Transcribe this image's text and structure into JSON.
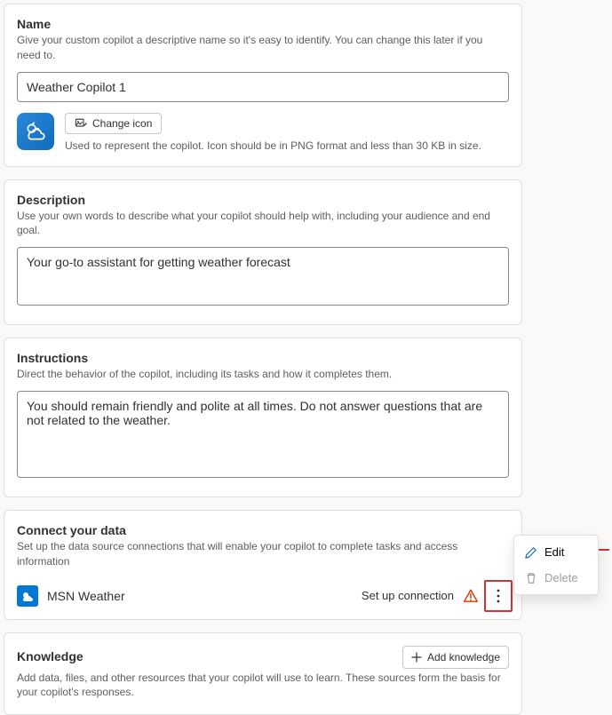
{
  "name": {
    "title": "Name",
    "desc": "Give your custom copilot a descriptive name so it's easy to identify. You can change this later if you need to.",
    "value": "Weather Copilot 1",
    "change_icon_label": "Change icon",
    "icon_help": "Used to represent the copilot. Icon should be in PNG format and less than 30 KB in size."
  },
  "description": {
    "title": "Description",
    "desc": "Use your own words to describe what your copilot should help with, including your audience and end goal.",
    "value": "Your go-to assistant for getting weather forecast"
  },
  "instructions": {
    "title": "Instructions",
    "desc": "Direct the behavior of the copilot, including its tasks and how it completes them.",
    "value": "You should remain friendly and polite at all times. Do not answer questions that are not related to the weather."
  },
  "connect": {
    "title": "Connect your data",
    "desc": "Set up the data source connections that will enable your copilot to complete tasks and access information",
    "source_label": "MSN Weather",
    "status": "Set up connection"
  },
  "knowledge": {
    "title": "Knowledge",
    "add_label": "Add knowledge",
    "desc": "Add data, files, and other resources that your copilot will use to learn. These sources form the basis for your copilot's responses."
  },
  "menu": {
    "edit": "Edit",
    "delete": "Delete"
  }
}
